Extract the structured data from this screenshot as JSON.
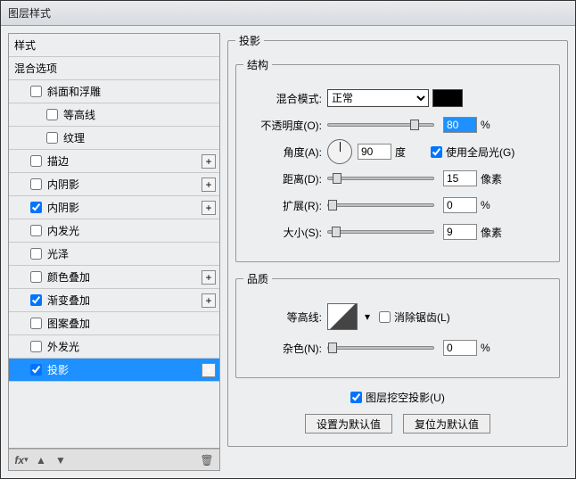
{
  "window": {
    "title": "图层样式"
  },
  "sidebar": {
    "header1": "样式",
    "header2": "混合选项",
    "items": [
      {
        "label": "斜面和浮雕",
        "checked": false,
        "plus": false,
        "indent": 1
      },
      {
        "label": "等高线",
        "checked": false,
        "plus": false,
        "indent": 2
      },
      {
        "label": "纹理",
        "checked": false,
        "plus": false,
        "indent": 2
      },
      {
        "label": "描边",
        "checked": false,
        "plus": true,
        "indent": 1
      },
      {
        "label": "内阴影",
        "checked": false,
        "plus": true,
        "indent": 1
      },
      {
        "label": "内阴影",
        "checked": true,
        "plus": true,
        "indent": 1
      },
      {
        "label": "内发光",
        "checked": false,
        "plus": false,
        "indent": 1
      },
      {
        "label": "光泽",
        "checked": false,
        "plus": false,
        "indent": 1
      },
      {
        "label": "颜色叠加",
        "checked": false,
        "plus": true,
        "indent": 1
      },
      {
        "label": "渐变叠加",
        "checked": true,
        "plus": true,
        "indent": 1
      },
      {
        "label": "图案叠加",
        "checked": false,
        "plus": false,
        "indent": 1
      },
      {
        "label": "外发光",
        "checked": false,
        "plus": false,
        "indent": 1
      },
      {
        "label": "投影",
        "checked": true,
        "plus": true,
        "indent": 1,
        "selected": true
      }
    ],
    "footer": {
      "fx": "fx"
    }
  },
  "panel": {
    "title": "投影",
    "structure": {
      "legend": "结构",
      "blendMode": {
        "label": "混合模式:",
        "value": "正常"
      },
      "opacity": {
        "label": "不透明度(O):",
        "value": "80",
        "unit": "%"
      },
      "angle": {
        "label": "角度(A):",
        "value": "90",
        "unit": "度",
        "globalLabel": "使用全局光(G)",
        "globalChecked": true
      },
      "distance": {
        "label": "距离(D):",
        "value": "15",
        "unit": "像素"
      },
      "spread": {
        "label": "扩展(R):",
        "value": "0",
        "unit": "%"
      },
      "size": {
        "label": "大小(S):",
        "value": "9",
        "unit": "像素"
      }
    },
    "quality": {
      "legend": "品质",
      "contour": {
        "label": "等高线:",
        "antiAlias": "消除锯齿(L)",
        "antiAliasChecked": false
      },
      "noise": {
        "label": "杂色(N):",
        "value": "0",
        "unit": "%"
      }
    },
    "knockout": {
      "label": "图层挖空投影(U)",
      "checked": true
    },
    "buttons": {
      "setDefault": "设置为默认值",
      "resetDefault": "复位为默认值"
    }
  }
}
